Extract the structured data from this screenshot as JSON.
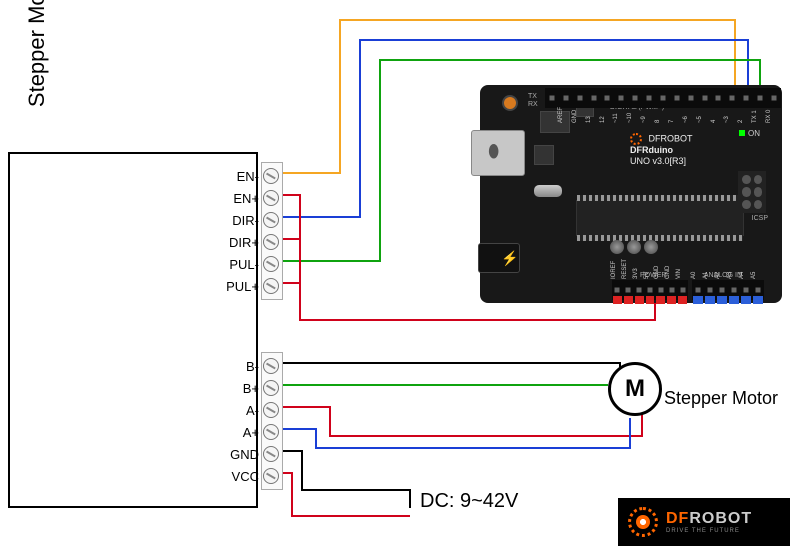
{
  "driver": {
    "title": "Stepper Motor Driver",
    "terminals_top": [
      {
        "label": "EN-"
      },
      {
        "label": "EN+"
      },
      {
        "label": "DIR-"
      },
      {
        "label": "DIR+"
      },
      {
        "label": "PUL-"
      },
      {
        "label": "PUL+"
      }
    ],
    "terminals_bot": [
      {
        "label": "B-"
      },
      {
        "label": "B+"
      },
      {
        "label": "A-"
      },
      {
        "label": "A+"
      },
      {
        "label": "GND"
      },
      {
        "label": "VCC"
      }
    ]
  },
  "arduino": {
    "brand": "DFROBOT",
    "model": "DFRduino",
    "version": "UNO v3.0[R3]",
    "on_label": "ON",
    "icsp_label": "ICSP",
    "digital_label": "DIGITAL (PWM~)",
    "power_label": "POWER",
    "analog_label": "ANALOG IN",
    "tx_label": "TX",
    "rx_label": "RX",
    "aref_label": "AREF",
    "digital_pins": [
      "",
      "AREF",
      "GND",
      "13",
      "12",
      "~11",
      "~10",
      "~9",
      "8",
      "7",
      "~6",
      "~5",
      "4",
      "~3",
      "2",
      "TX 1",
      "RX 0"
    ],
    "power_pins": [
      "IOREF",
      "RESET",
      "3V3",
      "5V",
      "GND",
      "GND",
      "VIN"
    ],
    "analog_pins": [
      "A0",
      "A1",
      "A2",
      "A3",
      "A4",
      "A5"
    ]
  },
  "motor": {
    "symbol": "M",
    "label": "Stepper Motor"
  },
  "power": {
    "dc_label": "DC: 9~42V"
  },
  "logo": {
    "df": "DF",
    "robot": "ROBOT",
    "tagline": "DRIVE THE FUTURE"
  },
  "wiring": {
    "colors": {
      "en_minus": "#f5a623",
      "en_plus": "#d0021b",
      "dir_minus": "#1a3fd6",
      "dir_plus": "#d0021b",
      "pul_minus": "#0fa30f",
      "pul_plus": "#d0021b",
      "motor_b_minus": "#000000",
      "motor_b_plus": "#0fa30f",
      "motor_a_minus": "#d0021b",
      "motor_a_plus": "#1a3fd6",
      "gnd": "#000000",
      "vcc": "#d0021b"
    },
    "connections": [
      {
        "from": "EN-",
        "to": "Arduino D4",
        "color": "orange"
      },
      {
        "from": "EN+",
        "to": "Arduino 5V",
        "color": "red"
      },
      {
        "from": "DIR-",
        "to": "Arduino D3",
        "color": "blue"
      },
      {
        "from": "DIR+",
        "to": "Arduino 5V",
        "color": "red"
      },
      {
        "from": "PUL-",
        "to": "Arduino D2",
        "color": "green"
      },
      {
        "from": "PUL+",
        "to": "Arduino 5V",
        "color": "red"
      },
      {
        "from": "B-",
        "to": "Motor coil B",
        "color": "black"
      },
      {
        "from": "B+",
        "to": "Motor coil B",
        "color": "green"
      },
      {
        "from": "A-",
        "to": "Motor coil A",
        "color": "red"
      },
      {
        "from": "A+",
        "to": "Motor coil A",
        "color": "blue"
      },
      {
        "from": "GND",
        "to": "DC 9~42V -",
        "color": "black"
      },
      {
        "from": "VCC",
        "to": "DC 9~42V +",
        "color": "red"
      }
    ]
  }
}
